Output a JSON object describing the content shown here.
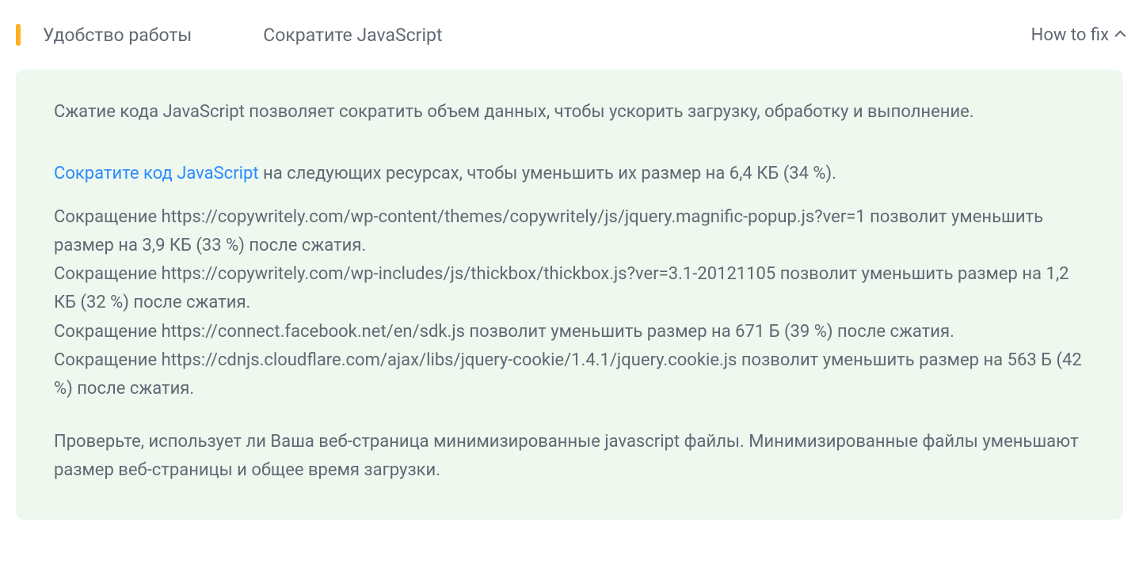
{
  "header": {
    "category": "Удобство работы",
    "title": "Сократите JavaScript",
    "how_to_fix_label": "How to fix"
  },
  "intro": "Сжатие кода JavaScript позволяет сократить объем данных, чтобы ускорить загрузку, обработку и выполнение.",
  "summary": {
    "link_text": "Сократите код JavaScript",
    "rest": " на следующих ресурсах, чтобы уменьшить их размер на 6,4 КБ (34 %)."
  },
  "items": [
    {
      "pre": "Сокращение ",
      "url": "https://copywritely.com/wp-content/themes/copywritely/js/jquery.magnific-popup.js?ver=1",
      "post": " позволит уменьшить размер на 3,9 КБ (33 %) после сжатия."
    },
    {
      "pre": "Сокращение ",
      "url": "https://copywritely.com/wp-includes/js/thickbox/thickbox.js?ver=3.1-20121105",
      "post": " позволит уменьшить размер на 1,2 КБ (32 %) после сжатия."
    },
    {
      "pre": "Сокращение ",
      "url": "https://connect.facebook.net/en/sdk.js",
      "post": " позволит уменьшить размер на 671 Б (39 %) после сжатия."
    },
    {
      "pre": "Сокращение ",
      "url": "https://cdnjs.cloudflare.com/ajax/libs/jquery-cookie/1.4.1/jquery.cookie.js",
      "post": " позволит уменьшить размер на 563 Б (42 %) после сжатия."
    }
  ],
  "closing": "Проверьте, использует ли Ваша веб-страница минимизированные javascript файлы. Минимизированные файлы уменьшают размер веб-страницы и общее время загрузки."
}
